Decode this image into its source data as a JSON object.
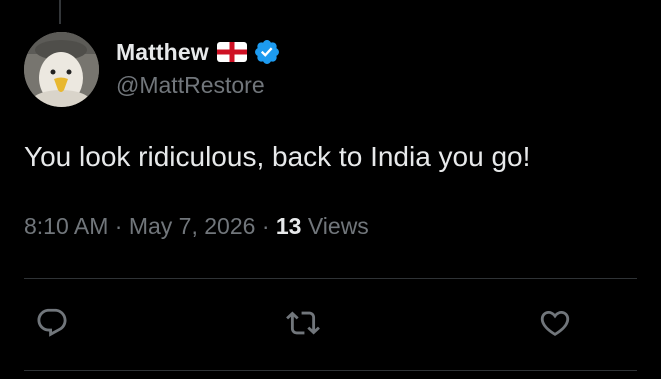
{
  "tweet": {
    "author": {
      "display_name": "Matthew",
      "handle": "@MattRestore",
      "flag_icon": "england-flag-icon",
      "verified_icon": "verified-badge-icon"
    },
    "text": "You look ridiculous, back to India you go!",
    "meta": {
      "time": "8:10 AM",
      "separator": "·",
      "date": "May 7, 2026",
      "views_count": "13",
      "views_label": "Views"
    },
    "actions": {
      "reply_icon": "reply-icon",
      "retweet_icon": "retweet-icon",
      "like_icon": "heart-icon"
    }
  },
  "colors": {
    "background": "#000000",
    "text_primary": "#e7e9ea",
    "text_secondary": "#71767b",
    "divider": "#2f3336",
    "verified_blue": "#1d9bf0"
  }
}
